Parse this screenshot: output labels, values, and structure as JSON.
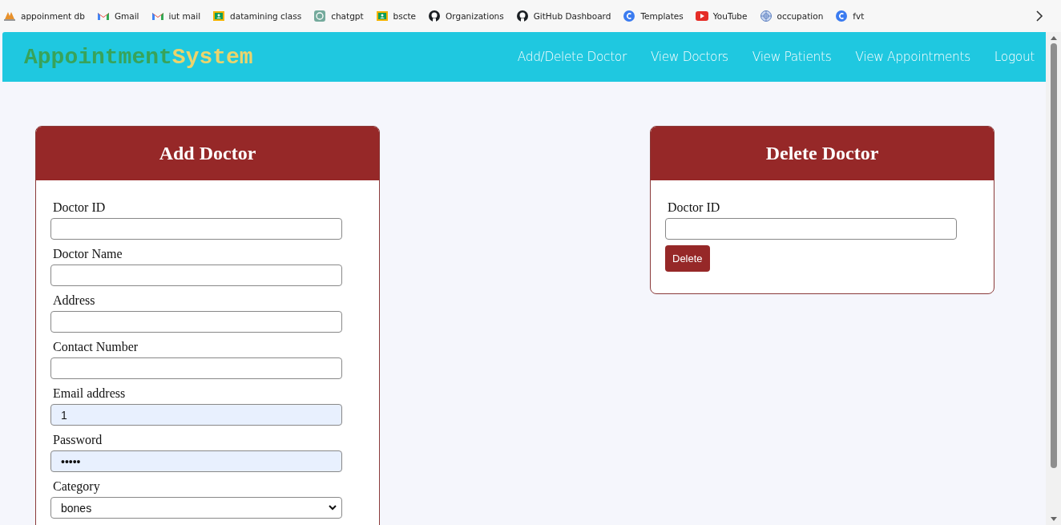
{
  "bookmarks": [
    {
      "label": "appoinment db",
      "kind": "pma"
    },
    {
      "label": "Gmail",
      "kind": "gmail"
    },
    {
      "label": "iut mail",
      "kind": "gmail"
    },
    {
      "label": "datamining class",
      "kind": "classroom"
    },
    {
      "label": "chatgpt",
      "kind": "chatgpt"
    },
    {
      "label": "bscte",
      "kind": "classroom"
    },
    {
      "label": "Organizations",
      "kind": "github"
    },
    {
      "label": "GitHub Dashboard",
      "kind": "github"
    },
    {
      "label": "Templates",
      "kind": "canva"
    },
    {
      "label": "YouTube",
      "kind": "youtube"
    },
    {
      "label": "occupation",
      "kind": "globe"
    },
    {
      "label": "fvt",
      "kind": "canva"
    }
  ],
  "logo": {
    "part_1": "Appointment",
    "part_2": "System"
  },
  "nav": [
    "Add/Delete Doctor",
    "View Doctors",
    "View Patients",
    "View Appointments",
    "Logout"
  ],
  "cards": [
    {
      "title": "Add Doctor",
      "fields": [
        {
          "label": "Doctor ID",
          "kind": "text",
          "autofilled": false
        },
        {
          "label": "Doctor Name",
          "kind": "text",
          "autofilled": false
        },
        {
          "label": "Address",
          "kind": "text",
          "autofilled": false
        },
        {
          "label": "Contact Number",
          "kind": "text",
          "autofilled": false
        },
        {
          "label": "Email address",
          "kind": "text",
          "value": "1",
          "autofilled": true
        },
        {
          "label": "Password",
          "kind": "text",
          "value": "•••••",
          "autofilled": true
        },
        {
          "label": "Category",
          "kind": "select",
          "value": "bones",
          "autofilled": false
        }
      ]
    },
    {
      "title": "Delete Doctor",
      "fields": [
        {
          "label": "Doctor ID",
          "kind": "text",
          "autofilled": false
        }
      ],
      "button": "Delete"
    }
  ]
}
